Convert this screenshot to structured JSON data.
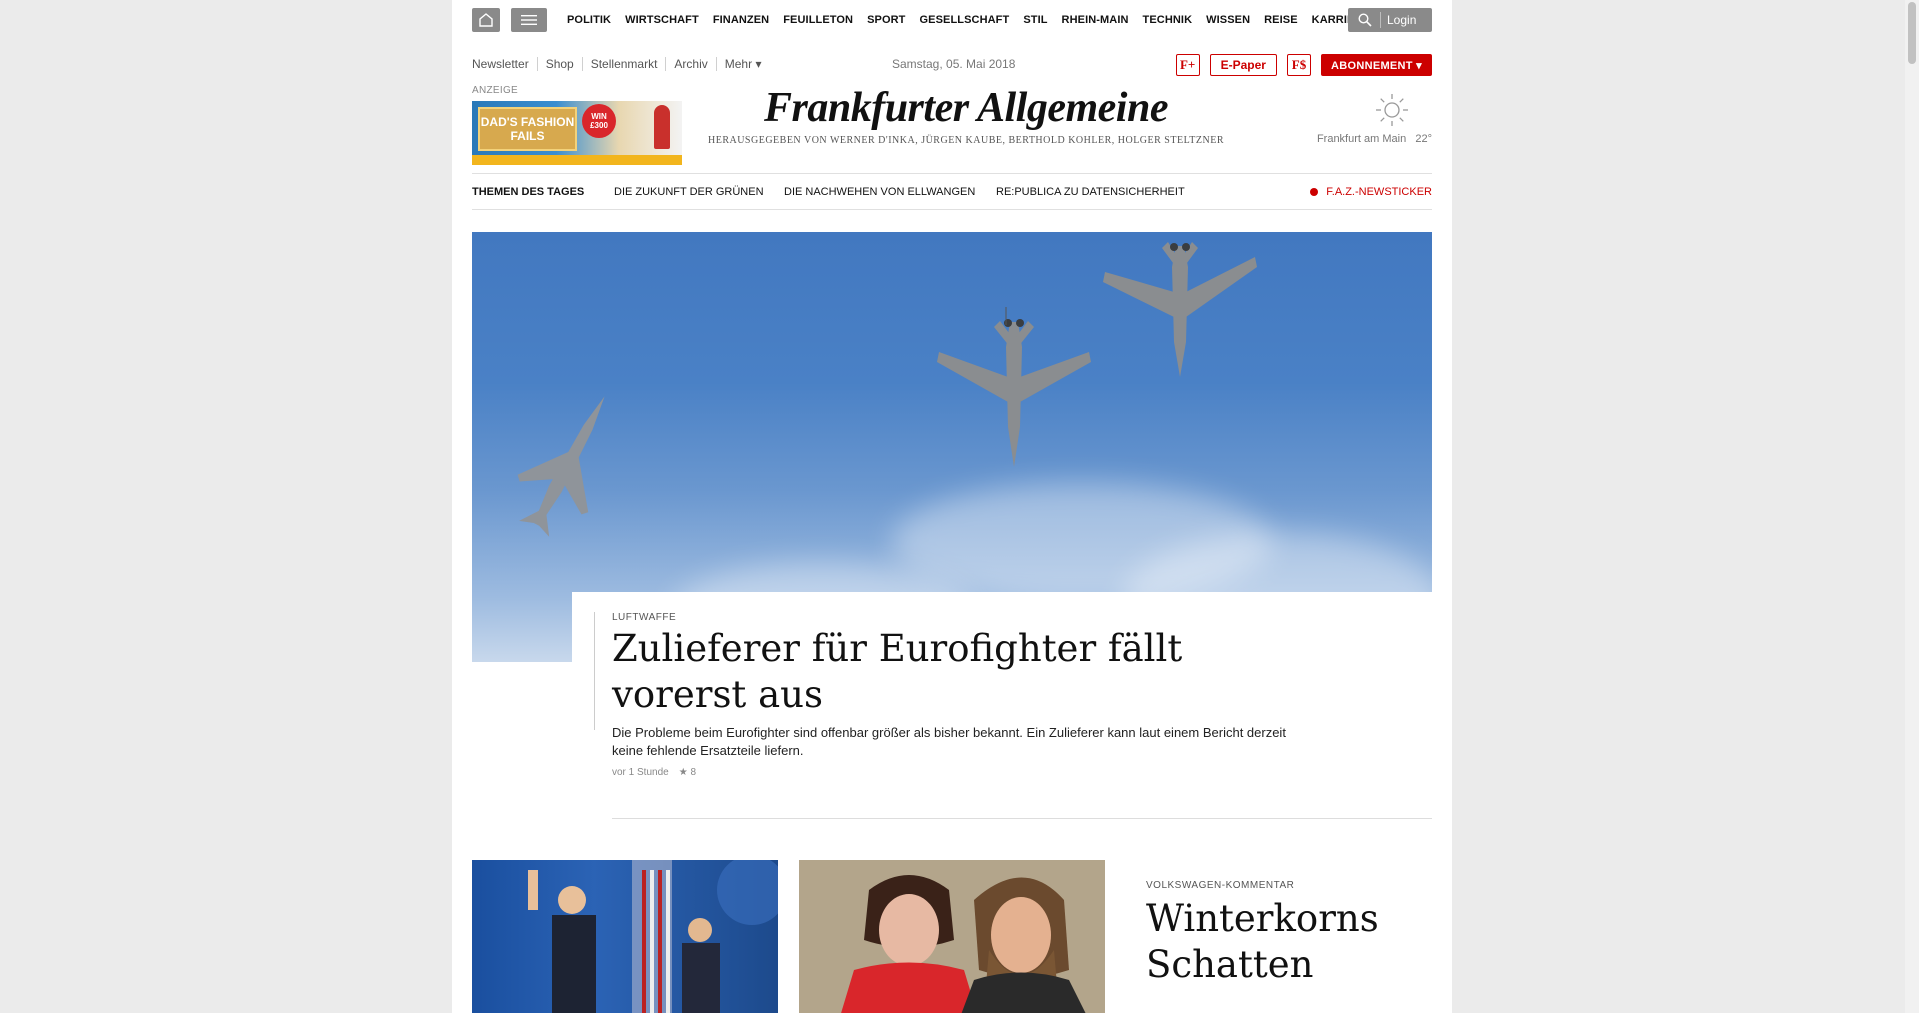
{
  "topnav": {
    "items": [
      "POLITIK",
      "WIRTSCHAFT",
      "FINANZEN",
      "FEUILLETON",
      "SPORT",
      "GESELLSCHAFT",
      "STIL",
      "RHEIN-MAIN",
      "TECHNIK",
      "WISSEN",
      "REISE",
      "KARRIERE"
    ],
    "login_label": "Login",
    "home_icon": "home-icon",
    "menu_icon": "hamburger-icon",
    "search_icon": "search-icon"
  },
  "service": {
    "links": [
      "Newsletter",
      "Shop",
      "Stellenmarkt",
      "Archiv",
      "Mehr ▾"
    ],
    "date": "Samstag, 05. Mai 2018",
    "fplus_label": "F+",
    "epaper_label": "E-Paper",
    "fdollar_label": "F$",
    "abo_label": "ABONNEMENT ▾"
  },
  "ad": {
    "label": "ANZEIGE",
    "line1": "DAD'S FASHION",
    "line2": "FAILS",
    "win_line1": "WIN",
    "win_line2": "£300"
  },
  "masthead": {
    "title": "Frankfurter Allgemeine",
    "subtitle": "HERAUSGEGEBEN VON WERNER D'INKA, JÜRGEN KAUBE, BERTHOLD KOHLER, HOLGER STELTZNER"
  },
  "weather": {
    "icon": "sun-icon",
    "location": "Frankfurt am Main",
    "temp": "22°"
  },
  "themes": {
    "heading": "THEMEN DES TAGES",
    "items": [
      "DIE ZUKUNFT DER GRÜNEN",
      "DIE NACHWEHEN VON ELLWANGEN",
      "RE:PUBLICA ZU DATENSICHERHEIT"
    ],
    "newsticker": "F.A.Z.-NEWSTICKER"
  },
  "hero": {
    "kicker": "LUFTWAFFE",
    "title": "Zulieferer für Eurofighter fällt vorerst aus",
    "teaser": "Die Probleme beim Eurofighter sind offenbar größer als bisher bekannt. Ein Zulieferer kann laut einem Bericht derzeit keine fehlende Ersatzteile liefern.",
    "time": "vor 1 Stunde",
    "rating": "★ 8"
  },
  "comment": {
    "kicker": "VOLKSWAGEN-KOMMENTAR",
    "title": "Winterkorns Schatten"
  }
}
